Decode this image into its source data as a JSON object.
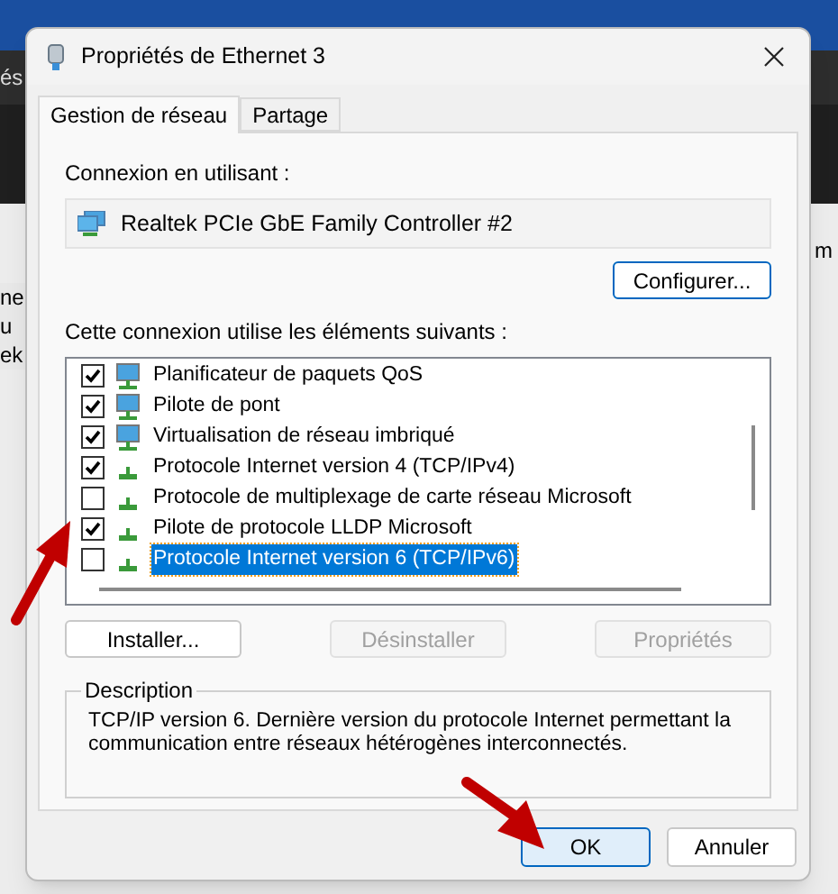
{
  "background": {
    "fragments_left": [
      "és",
      "ne",
      "u",
      "ek"
    ],
    "fragments_right": [
      "m"
    ]
  },
  "window": {
    "title": "Propriétés de Ethernet 3"
  },
  "tabs": [
    {
      "label": "Gestion de réseau",
      "selected": true
    },
    {
      "label": "Partage",
      "selected": false
    }
  ],
  "connection": {
    "label": "Connexion en utilisant :",
    "adapter": "Realtek PCIe GbE Family Controller #2",
    "configure_button": "Configurer..."
  },
  "components": {
    "label": "Cette connexion utilise les éléments suivants :",
    "items": [
      {
        "name": "Planificateur de paquets QoS",
        "kind": "service",
        "checked": true,
        "selected": false
      },
      {
        "name": "Pilote de pont",
        "kind": "service",
        "checked": true,
        "selected": false
      },
      {
        "name": "Virtualisation de réseau imbriqué",
        "kind": "service",
        "checked": true,
        "selected": false
      },
      {
        "name": "Protocole Internet version 4 (TCP/IPv4)",
        "kind": "protocol",
        "checked": true,
        "selected": false
      },
      {
        "name": "Protocole de multiplexage de carte réseau Microsoft",
        "kind": "protocol",
        "checked": false,
        "selected": false
      },
      {
        "name": "Pilote de protocole LLDP Microsoft",
        "kind": "protocol",
        "checked": true,
        "selected": false
      },
      {
        "name": "Protocole Internet version 6 (TCP/IPv6)",
        "kind": "protocol",
        "checked": false,
        "selected": true
      }
    ]
  },
  "actions": [
    {
      "label": "Installer...",
      "disabled": false
    },
    {
      "label": "Désinstaller",
      "disabled": true
    },
    {
      "label": "Propriétés",
      "disabled": true
    }
  ],
  "description": {
    "title": "Description",
    "text": "TCP/IP version 6. Dernière version du protocole Internet permettant la communication entre réseaux hétérogènes interconnectés."
  },
  "footer_buttons": [
    {
      "label": "OK",
      "default": true
    },
    {
      "label": "Annuler",
      "default": false
    }
  ]
}
